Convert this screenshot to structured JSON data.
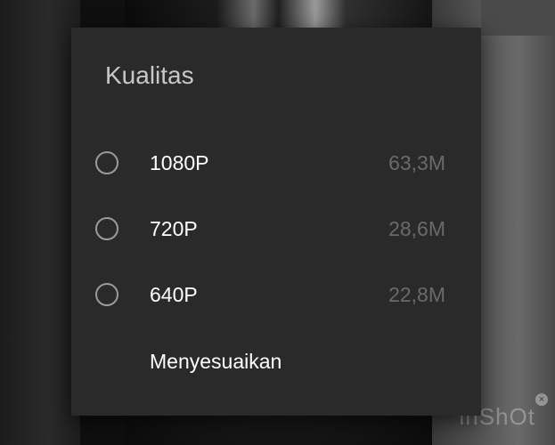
{
  "dialog": {
    "title": "Kualitas",
    "options": [
      {
        "label": "1080P",
        "size": "63,3M",
        "selected": false
      },
      {
        "label": "720P",
        "size": "28,6M",
        "selected": false
      },
      {
        "label": "640P",
        "size": "22,8M",
        "selected": false
      }
    ],
    "custom_label": "Menyesuaikan"
  },
  "watermark": {
    "text": "inShOt",
    "close_icon": "close-icon"
  },
  "colors": {
    "dialog_bg": "#2a2a2a",
    "title": "#c8c8c8",
    "option_text": "#ffffff",
    "size_text": "#6a6a6a",
    "radio": "#9a9a9a"
  }
}
